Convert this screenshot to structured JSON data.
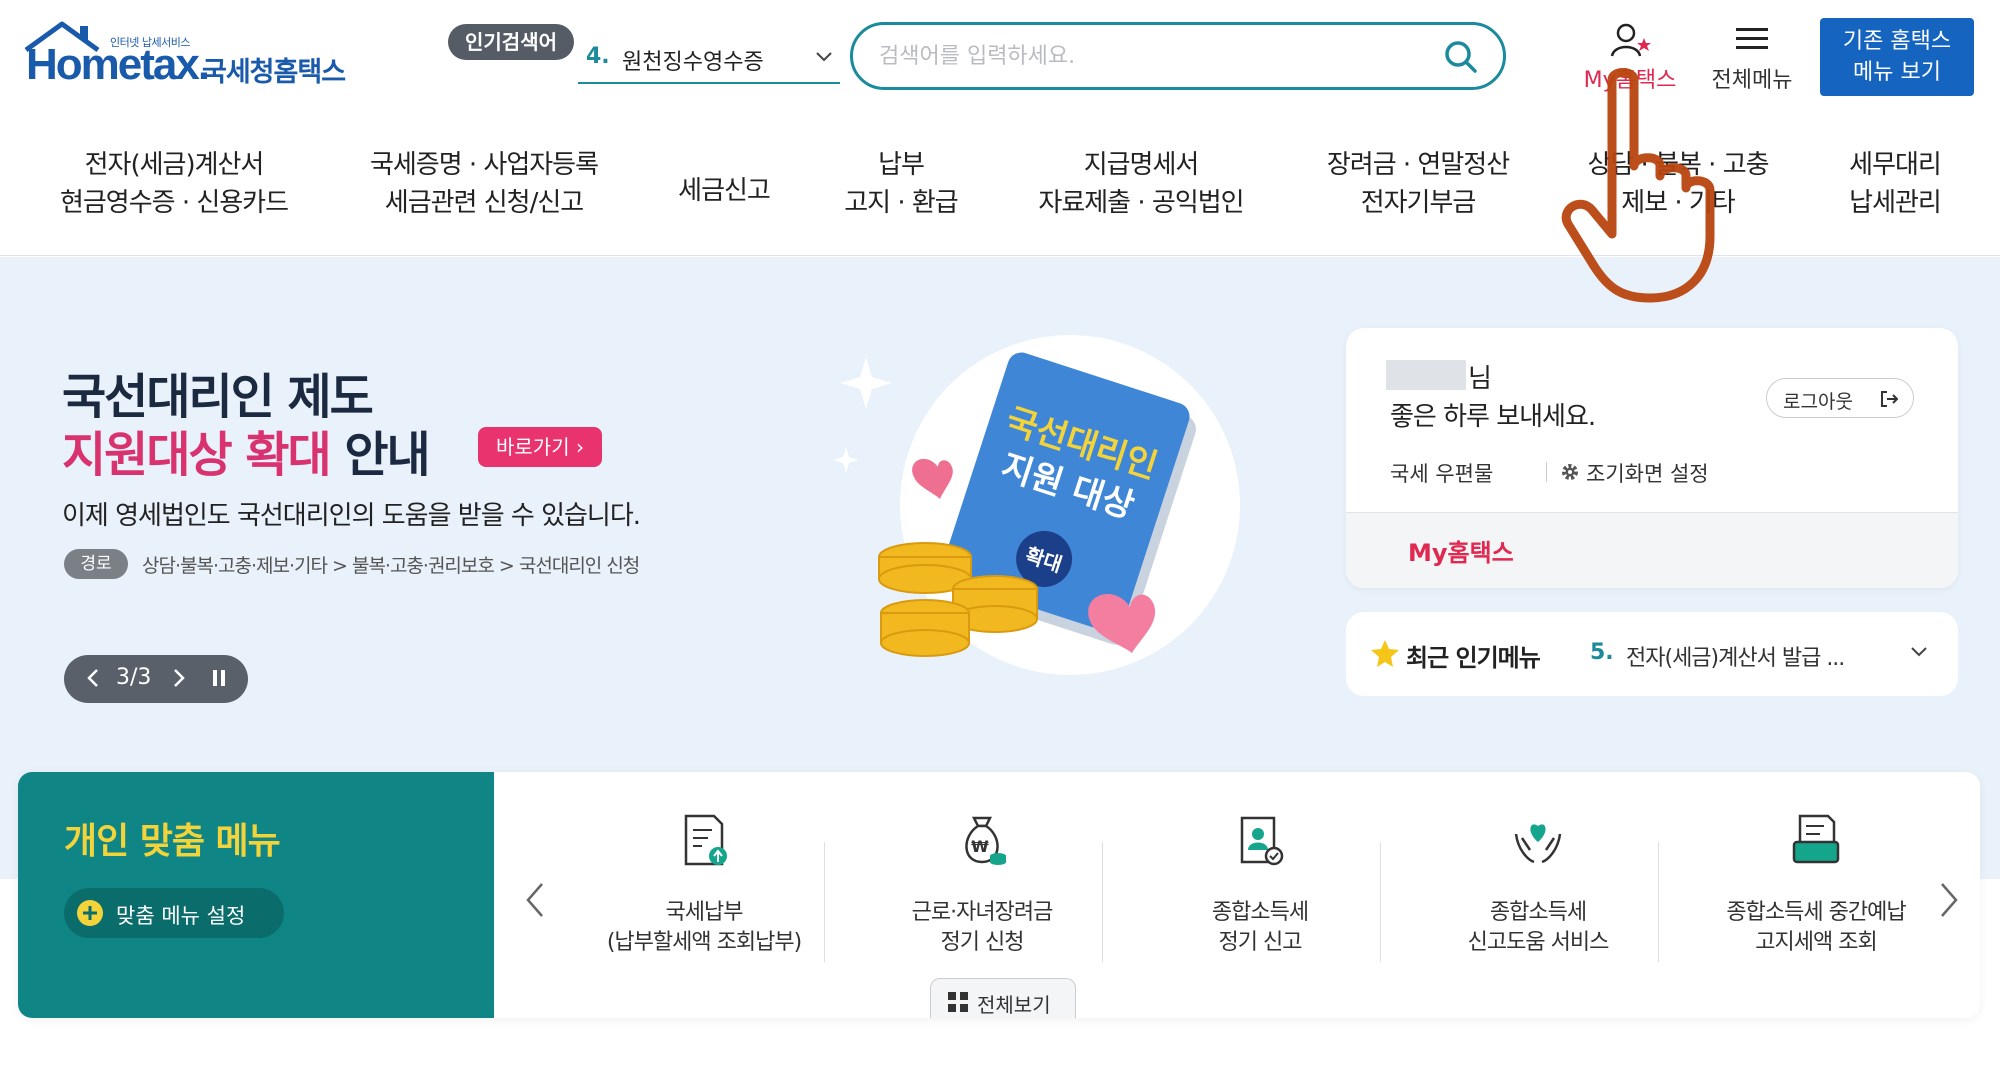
{
  "header": {
    "logo_subtitle": "인터넷 납세서비스",
    "logo_text": "Hometax.",
    "logo_name": "국세청홈택스",
    "popular_search_label": "인기검색어",
    "popular_search_rank": "4.",
    "popular_search_term": "원천징수영수증",
    "search_placeholder": "검색어를 입력하세요.",
    "my_hometax": "My홈택스",
    "all_menu": "전체메뉴",
    "legacy_line1": "기존 홈택스",
    "legacy_line2": "메뉴 보기"
  },
  "nav": [
    {
      "line1": "전자(세금)계산서",
      "line2": "현금영수증 · 신용카드"
    },
    {
      "line1": "국세증명 · 사업자등록",
      "line2": "세금관련 신청/신고"
    },
    {
      "line1": "세금신고",
      "line2": ""
    },
    {
      "line1": "납부",
      "line2": "고지 · 환급"
    },
    {
      "line1": "지급명세서",
      "line2": "자료제출 · 공익법인"
    },
    {
      "line1": "장려금 · 연말정산",
      "line2": "전자기부금"
    },
    {
      "line1": "상담 · 불복 · 고충",
      "line2": "제보 · 기타"
    },
    {
      "line1": "세무대리",
      "line2": "납세관리"
    }
  ],
  "hero": {
    "title_line1": "국선대리인 제도",
    "title_line2_highlight": "지원대상 확대",
    "title_line2_rest": " 안내",
    "go_button": "바로가기",
    "description": "이제 영세법인도 국선대리인의 도움을 받을 수 있습니다.",
    "path_tag": "경로",
    "path": "상담·불복·고충·제보·기타 > 불복·고충·권리보호 > 국선대리인 신청",
    "pager": "3/3",
    "book_title_line1": "국선대리인",
    "book_title_line2": "지원 대상",
    "book_badge": "확대"
  },
  "login_card": {
    "greeting_suffix": "님",
    "greeting_line": "좋은 하루 보내세요.",
    "logout": "로그아웃",
    "mailbox": "국세 우편물",
    "initial_screen": "조기화면 설정",
    "my_hometax": "My홈택스"
  },
  "recent_popular": {
    "title": "최근 인기메뉴",
    "rank": "5.",
    "item": "전자(세금)계산서 발급 ..."
  },
  "personal_menu": {
    "title": "개인 맞춤 메뉴",
    "setting": "맞춤 메뉴 설정",
    "view_all": "전체보기",
    "services": [
      {
        "line1": "국세납부",
        "line2": "(납부할세액 조회납부)",
        "icon": "tax-payment-icon"
      },
      {
        "line1": "근로·자녀장려금",
        "line2": "정기 신청",
        "icon": "money-bag-icon"
      },
      {
        "line1": "종합소득세",
        "line2": "정기 신고",
        "icon": "income-tax-report-icon"
      },
      {
        "line1": "종합소득세",
        "line2": "신고도움 서비스",
        "icon": "heart-hands-icon"
      },
      {
        "line1": "종합소득세 중간예납",
        "line2": "고지세액 조회",
        "icon": "notice-inquiry-icon"
      }
    ]
  },
  "colors": {
    "brand_blue": "#1565c0",
    "teal": "#0f8585",
    "accent_pink": "#e8336f",
    "my_red": "#e02850"
  }
}
